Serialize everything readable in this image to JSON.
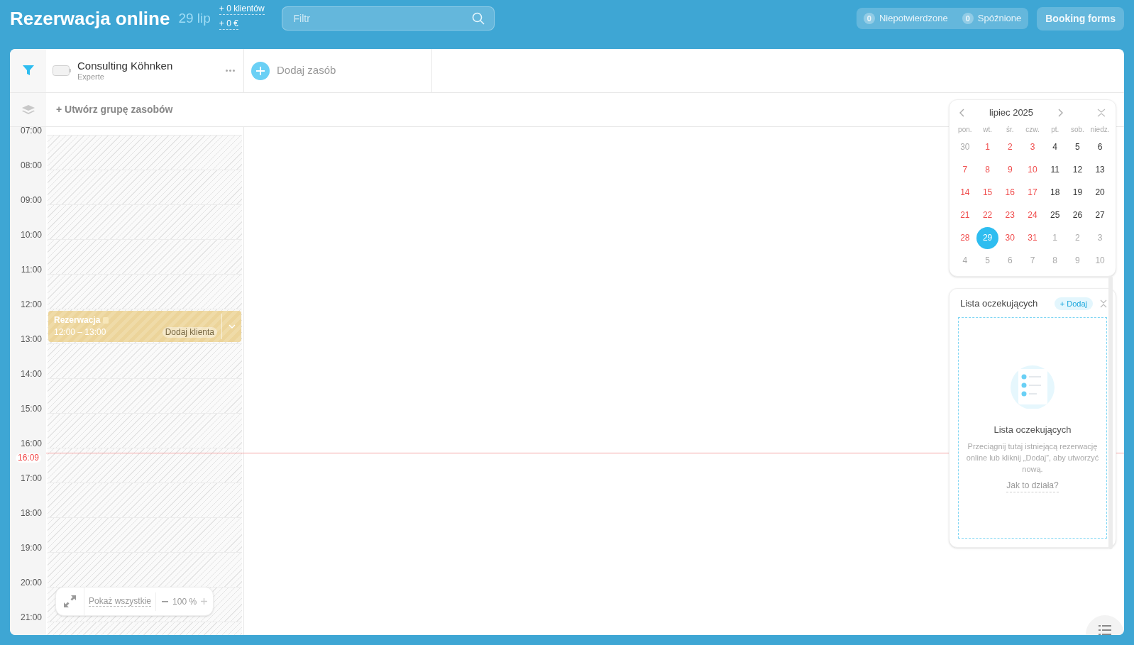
{
  "header": {
    "title": "Rezerwacja online",
    "date": "29 lip",
    "clients": "+ 0 klientów",
    "revenue": "+ 0 €",
    "filter": {
      "placeholder": "Filtr"
    },
    "counters": [
      {
        "count": "0",
        "label": "Niepotwierdzone"
      },
      {
        "count": "0",
        "label": "Spóźnione"
      }
    ],
    "booking_forms": "Booking forms"
  },
  "resources": [
    {
      "name": "Consulting Köhnken",
      "subtitle": "Experte"
    }
  ],
  "add_resource": "Dodaj zasób",
  "create_group": "+ Utwórz grupę zasobów",
  "hours": [
    "07:00",
    "08:00",
    "09:00",
    "10:00",
    "11:00",
    "12:00",
    "13:00",
    "14:00",
    "15:00",
    "16:00",
    "17:00",
    "18:00",
    "19:00",
    "20:00",
    "21:00"
  ],
  "now": {
    "label": "16:09"
  },
  "bookings": [
    {
      "title": "Rezerwacja",
      "time": "12:00 – 13:00",
      "action": "Dodaj klienta"
    }
  ],
  "zoom": {
    "show_all": "Pokaż wszystkie",
    "value": "100 %"
  },
  "calendar": {
    "month": "lipiec 2025",
    "weekdays": [
      "pon.",
      "wt.",
      "śr.",
      "czw.",
      "pt.",
      "sob.",
      "niedz."
    ],
    "weeks": [
      [
        {
          "label": "30",
          "kind": "other",
          "selected": false
        },
        {
          "label": "1",
          "kind": "closed",
          "selected": false
        },
        {
          "label": "2",
          "kind": "closed",
          "selected": false
        },
        {
          "label": "3",
          "kind": "closed",
          "selected": false
        },
        {
          "label": "4",
          "kind": "open",
          "selected": false
        },
        {
          "label": "5",
          "kind": "open",
          "selected": false
        },
        {
          "label": "6",
          "kind": "open",
          "selected": false
        }
      ],
      [
        {
          "label": "7",
          "kind": "closed",
          "selected": false
        },
        {
          "label": "8",
          "kind": "closed",
          "selected": false
        },
        {
          "label": "9",
          "kind": "closed",
          "selected": false
        },
        {
          "label": "10",
          "kind": "closed",
          "selected": false
        },
        {
          "label": "11",
          "kind": "open",
          "selected": false
        },
        {
          "label": "12",
          "kind": "open",
          "selected": false
        },
        {
          "label": "13",
          "kind": "open",
          "selected": false
        }
      ],
      [
        {
          "label": "14",
          "kind": "closed",
          "selected": false
        },
        {
          "label": "15",
          "kind": "closed",
          "selected": false
        },
        {
          "label": "16",
          "kind": "closed",
          "selected": false
        },
        {
          "label": "17",
          "kind": "closed",
          "selected": false
        },
        {
          "label": "18",
          "kind": "open",
          "selected": false
        },
        {
          "label": "19",
          "kind": "open",
          "selected": false
        },
        {
          "label": "20",
          "kind": "open",
          "selected": false
        }
      ],
      [
        {
          "label": "21",
          "kind": "closed",
          "selected": false
        },
        {
          "label": "22",
          "kind": "closed",
          "selected": false
        },
        {
          "label": "23",
          "kind": "closed",
          "selected": false
        },
        {
          "label": "24",
          "kind": "closed",
          "selected": false
        },
        {
          "label": "25",
          "kind": "open",
          "selected": false
        },
        {
          "label": "26",
          "kind": "open",
          "selected": false
        },
        {
          "label": "27",
          "kind": "open",
          "selected": false
        }
      ],
      [
        {
          "label": "28",
          "kind": "closed",
          "selected": false
        },
        {
          "label": "29",
          "kind": "closed",
          "selected": true
        },
        {
          "label": "30",
          "kind": "closed",
          "selected": false
        },
        {
          "label": "31",
          "kind": "closed",
          "selected": false
        },
        {
          "label": "1",
          "kind": "other",
          "selected": false
        },
        {
          "label": "2",
          "kind": "other",
          "selected": false
        },
        {
          "label": "3",
          "kind": "other",
          "selected": false
        }
      ],
      [
        {
          "label": "4",
          "kind": "other",
          "selected": false
        },
        {
          "label": "5",
          "kind": "other",
          "selected": false
        },
        {
          "label": "6",
          "kind": "other",
          "selected": false
        },
        {
          "label": "7",
          "kind": "other",
          "selected": false
        },
        {
          "label": "8",
          "kind": "other",
          "selected": false
        },
        {
          "label": "9",
          "kind": "other",
          "selected": false
        },
        {
          "label": "10",
          "kind": "other",
          "selected": false
        }
      ]
    ]
  },
  "waitlist": {
    "title": "Lista oczekujących",
    "add": "+ Dodaj",
    "empty_title": "Lista oczekujących",
    "empty_text": "Przeciągnij tutaj istniejącą rezerwację online lub kliknij „Dodaj”, aby utworzyć nową.",
    "help_link": "Jak to działa?"
  }
}
